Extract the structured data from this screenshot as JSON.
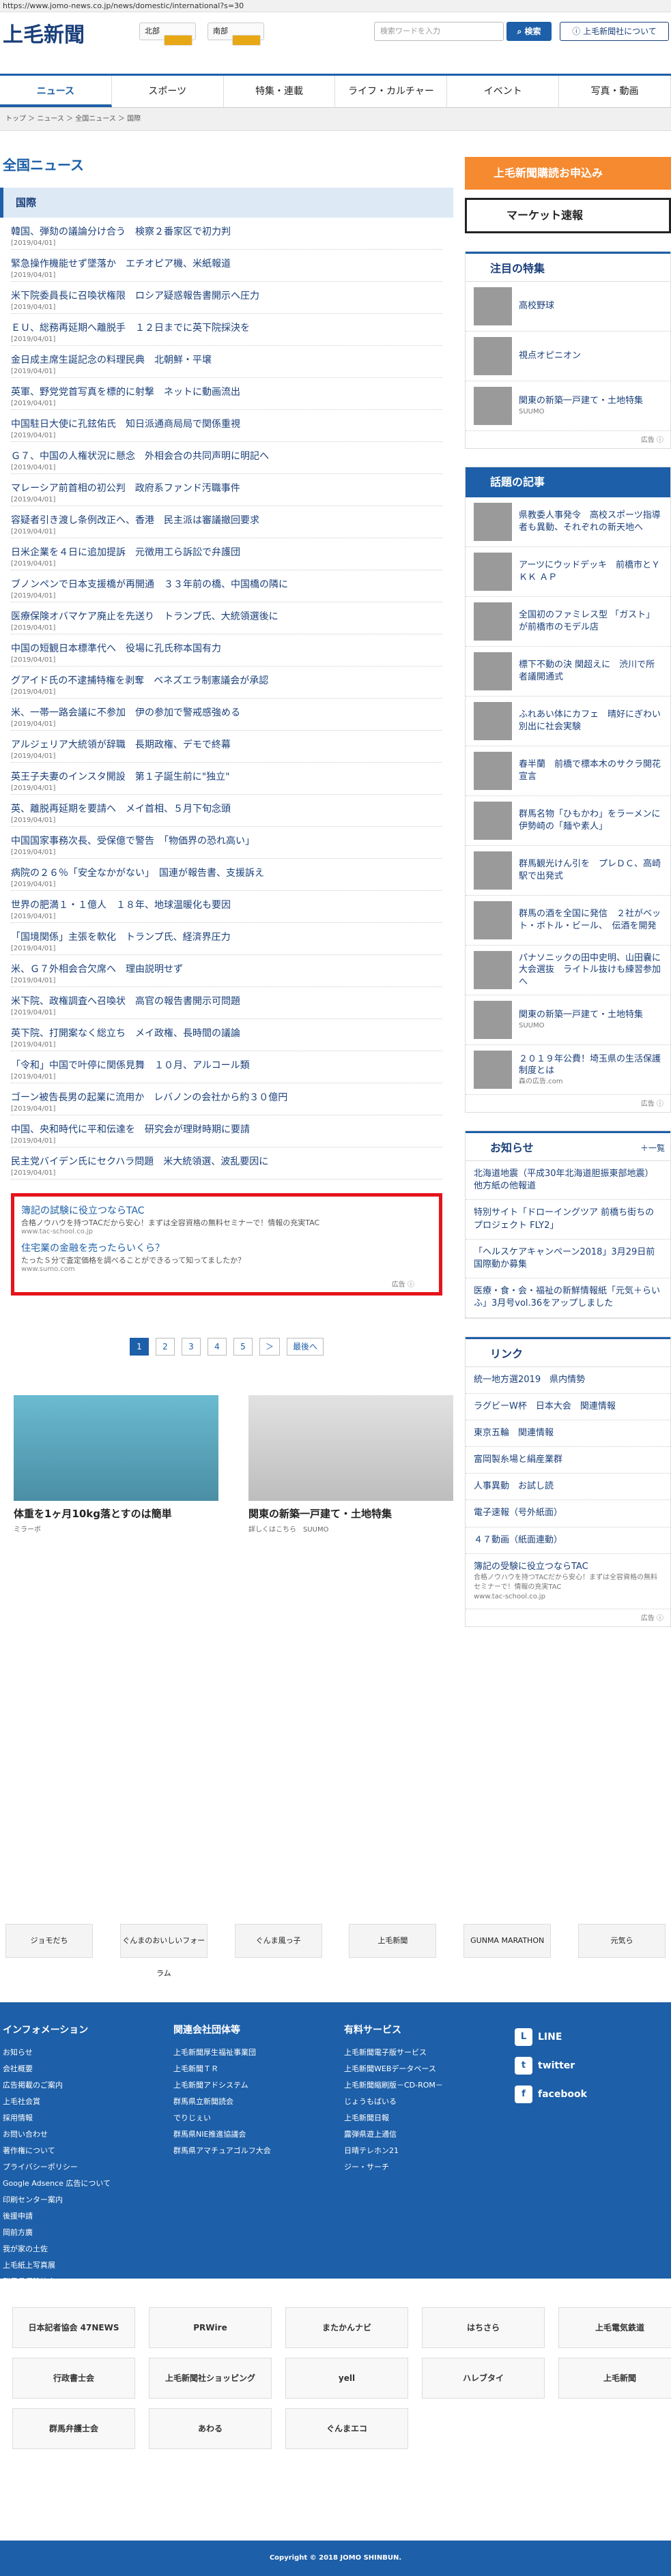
{
  "url": "https://www.jomo-news.co.jp/news/domestic/international?s=30",
  "logo": "上毛新聞",
  "header": {
    "north": "北部",
    "south": "南部",
    "search_placeholder": "検索ワードを入力",
    "search_button": "検索",
    "about": "上毛新聞社について"
  },
  "nav": [
    "ニュース",
    "スポーツ",
    "特集・連載",
    "ライフ・カルチャー",
    "イベント",
    "写真・動画"
  ],
  "breadcrumb": "トップ ＞ ニュース ＞ 全国ニュース ＞ 国際",
  "page_title": "全国ニュース",
  "section": "国際",
  "news": [
    {
      "t": "韓国、弾劾の議論分け合う　検察２番家区で初力判",
      "d": "[2019/04/01]"
    },
    {
      "t": "緊急操作機能せず墜落か　エチオピア機、米紙報道",
      "d": "[2019/04/01]"
    },
    {
      "t": "米下院委員長に召喚状権限　ロシア疑惑報告書開示へ圧力",
      "d": "[2019/04/01]"
    },
    {
      "t": "ＥＵ、総務再延期へ離脱手　１２日までに英下院採決を",
      "d": "[2019/04/01]"
    },
    {
      "t": "金日成主席生誕記念の料理民典　北朝鮮・平壌",
      "d": "[2019/04/01]"
    },
    {
      "t": "英軍、野党党首写真を標的に射撃　ネットに動画流出",
      "d": "[2019/04/01]"
    },
    {
      "t": "中国駐日大使に孔鉉佑氏　知日派通商局局で関係重視",
      "d": "[2019/04/01]"
    },
    {
      "t": "Ｇ７、中国の人権状況に懸念　外相会合の共同声明に明記へ",
      "d": "[2019/04/01]"
    },
    {
      "t": "マレーシア前首相の初公判　政府系ファンド汚職事件",
      "d": "[2019/04/01]"
    },
    {
      "t": "容疑者引き渡し条例改正へ、香港　民主派は審議撤回要求",
      "d": "[2019/04/01]"
    },
    {
      "t": "日米企業を４日に追加提訴　元徴用工ら訴訟で弁護団",
      "d": "[2019/04/01]"
    },
    {
      "t": "ブノンペンで日本支援橋が再開通　３３年前の橋、中国橋の隣に",
      "d": "[2019/04/01]"
    },
    {
      "t": "医療保険オバマケア廃止を先送り　トランプ氏、大統領選後に",
      "d": "[2019/04/01]"
    },
    {
      "t": "中国の短観日本標準代へ　役場に孔氏称本国有力",
      "d": "[2019/04/01]"
    },
    {
      "t": "グアイド氏の不逮捕特権を剥奪　ベネズエラ制憲議会が承認",
      "d": "[2019/04/01]"
    },
    {
      "t": "米、一帯一路会議に不参加　伊の参加で警戒感強める",
      "d": "[2019/04/01]"
    },
    {
      "t": "アルジェリア大統領が辞職　長期政権、デモで終幕",
      "d": "[2019/04/01]"
    },
    {
      "t": "英王子夫妻のインスタ開設　第１子誕生前に\"独立\"",
      "d": "[2019/04/01]"
    },
    {
      "t": "英、離脱再延期を要請へ　メイ首相、５月下旬念頭",
      "d": "[2019/04/01]"
    },
    {
      "t": "中国国家事務次長、受保億で警告　「物価界の恐れ高い」",
      "d": "[2019/04/01]"
    },
    {
      "t": "病院の２６％「安全なかがない」　国連が報告書、支援訴え",
      "d": "[2019/04/01]"
    },
    {
      "t": "世界の肥満１・１億人　１８年、地球温暖化も要因",
      "d": "[2019/04/01]"
    },
    {
      "t": "「国境関係」主張を軟化　トランプ氏、経済界圧力",
      "d": "[2019/04/01]"
    },
    {
      "t": "米、Ｇ７外相会合欠席へ　理由説明せず",
      "d": "[2019/04/01]"
    },
    {
      "t": "米下院、政権調査へ召喚状　高官の報告書開示可問題",
      "d": "[2019/04/01]"
    },
    {
      "t": "英下院、打開案なく総立ち　メイ政権、長時間の議論",
      "d": "[2019/04/01]"
    },
    {
      "t": "「令和」中国で叶停に関係見舞　１０月、アルコール類",
      "d": "[2019/04/01]"
    },
    {
      "t": "ゴーン被告長男の起業に流用か　レバノンの会社から約３０億円",
      "d": "[2019/04/01]"
    },
    {
      "t": "中国、央和時代に平和伝達を　研究会が理財時期に要請",
      "d": "[2019/04/01]"
    },
    {
      "t": "民主党バイデン氏にセクハラ問題　米大統領選、波乱要因に",
      "d": "[2019/04/01]"
    }
  ],
  "ad": {
    "h1": "簿記の試験に役立つならTAC",
    "s1": "合格ノウハウを持つTACだから安心！まずは全容資格の無料セミナーで！情報の充実TAC",
    "u1": "www.tac-school.co.jp",
    "h2": "住宅業の金融を売ったらいくら？",
    "s2": "たったＳ分で査定価格を調べることができるって知ってましたか？",
    "u2": "www.sumo.com",
    "note": "広告 ⓘ"
  },
  "pager": [
    "1",
    "2",
    "3",
    "4",
    "5",
    "＞",
    "最後へ"
  ],
  "cards": [
    {
      "t": "体重を1ヶ月10kg落とすのは簡単",
      "s": "ミラーボ"
    },
    {
      "t": "関東の新築一戸建て・土地特集",
      "s": "詳しくはこちら　SUUMO"
    }
  ],
  "side": {
    "subscribe": "上毛新聞購読お申込み",
    "market": "マーケット速報",
    "feature_title": "注目の特集",
    "features": [
      {
        "t": "高校野球"
      },
      {
        "t": "視点オピニオン"
      },
      {
        "t": "関東の新築一戸建て・土地特集",
        "s": "SUUMO"
      }
    ],
    "topics_title": "話題の記事",
    "topics": [
      {
        "t": "県教委人事発令　高校スポーツ指導者も異動、それぞれの新天地へ"
      },
      {
        "t": "アーツにウッドデッキ　前橋市とＹＫＫ ＡＰ"
      },
      {
        "t": "全国初のファミレス型 「ガスト」が前橋市のモデル店"
      },
      {
        "t": "標下不動の決 関超えに　渋川で所者議開通式"
      },
      {
        "t": "ふれあい体にカフェ　晴好にぎわい別出に社会実験"
      },
      {
        "t": "春半蘭　前橋で標本木のサクラ開花宣言"
      },
      {
        "t": "群馬名物「ひもかわ」をラーメンに　伊勢崎の「麺や素人」"
      },
      {
        "t": "群馬観光けん引を　プレＤＣ、高崎駅で出発式"
      },
      {
        "t": "群馬の酒を全国に発信　２社がベット・ボトル・ビール、　伝酒を開発"
      },
      {
        "t": "パナソニックの田中史明、山田嚢に大会選抜　ライトル抜けも練習参加へ"
      },
      {
        "t": "関東の新築一戸建て・土地特集",
        "s": "SUUMO"
      },
      {
        "t": "２０１９年公費！埼玉県の生活保護制度とは",
        "s": "森の広告.com"
      }
    ],
    "notice_title": "お知らせ",
    "notice_more": "＋一覧",
    "notices": [
      "北海道地震（平成30年北海道胆振東部地震）　他方紙の他報道",
      "特別サイト「ドローイングツア 前橋ち街ちのプロジェクト FLY2」",
      "「ヘルスケアキャンペーン2018」3月29日前国際動か募集",
      "医療・食・会・福祉の新鮮情報紙「元気＋らいふ」3月号vol.36をアップしました"
    ],
    "links_title": "リンク",
    "links": [
      "統一地方選2019　県内情勢",
      "ラグビーW杯　日本大会　関連情報",
      "東京五輪　関連情報",
      "富岡製糸場と絹産業群",
      "人事異動　お試し読",
      "電子速報（号外紙面）",
      "４７動画（紙面連動）"
    ],
    "link_ad": {
      "t": "簿記の受験に役立つならTAC",
      "s": "合格ノウハウを持つTACだから安心！まずは全容資格の無料セミナーで！情報の充実TAC",
      "u": "www.tac-school.co.jp"
    },
    "ad_label": "広告 ⓘ"
  },
  "banners": [
    "ジョモだち",
    "ぐんまのおいしいフォーラム",
    "ぐんま風っ子",
    "上毛新聞",
    "GUNMA MARATHON",
    "元気ら"
  ],
  "footer": {
    "col1_title": "インフォメーション",
    "col1": [
      "お知らせ",
      "会社概要",
      "広告掲載のご案内",
      "上毛社会賞",
      "採用情報",
      "お問い合わせ",
      "著作権について",
      "プライバシーポリシー",
      "Google Adsence 広告について",
      "印刷センター案内",
      "後援申請",
      "岡前方廣",
      "我が家の土佐",
      "上毛紙上写真展",
      "群馬県保険協会"
    ],
    "col2_title": "関連会社団体等",
    "col2": [
      "上毛新聞厚生福祉事業団",
      "上毛新聞ＴＲ",
      "上毛新聞アドシステム",
      "群馬県立新聞読会",
      "でりじぇい",
      "群馬県NIE推進協議会",
      "群馬県アマチュアゴルフ大会"
    ],
    "col3_title": "有料サービス",
    "col3": [
      "上毛新聞電子版サービス",
      "上毛新聞WEBデータベース",
      "上毛新聞縮刷版－CD-ROM－",
      "じょうもばいる",
      "上毛新聞日報",
      "露弾県遊上通信",
      "日晴テレホン21",
      "ジー・サーチ"
    ],
    "sns": [
      "LINE",
      "twitter",
      "facebook"
    ]
  },
  "sponsors": [
    "日本記者協会 47NEWS",
    "PRWire",
    "またかんナビ",
    "はちさら",
    "上毛電気鉄道",
    "行政書士会",
    "上毛新聞社ショッピング",
    "yell",
    "ハレブタイ",
    "上毛新聞",
    "群馬弁護士会",
    "あわる",
    "ぐんまエコ"
  ],
  "copyright": "Copyright © 2018 JOMO SHINBUN."
}
